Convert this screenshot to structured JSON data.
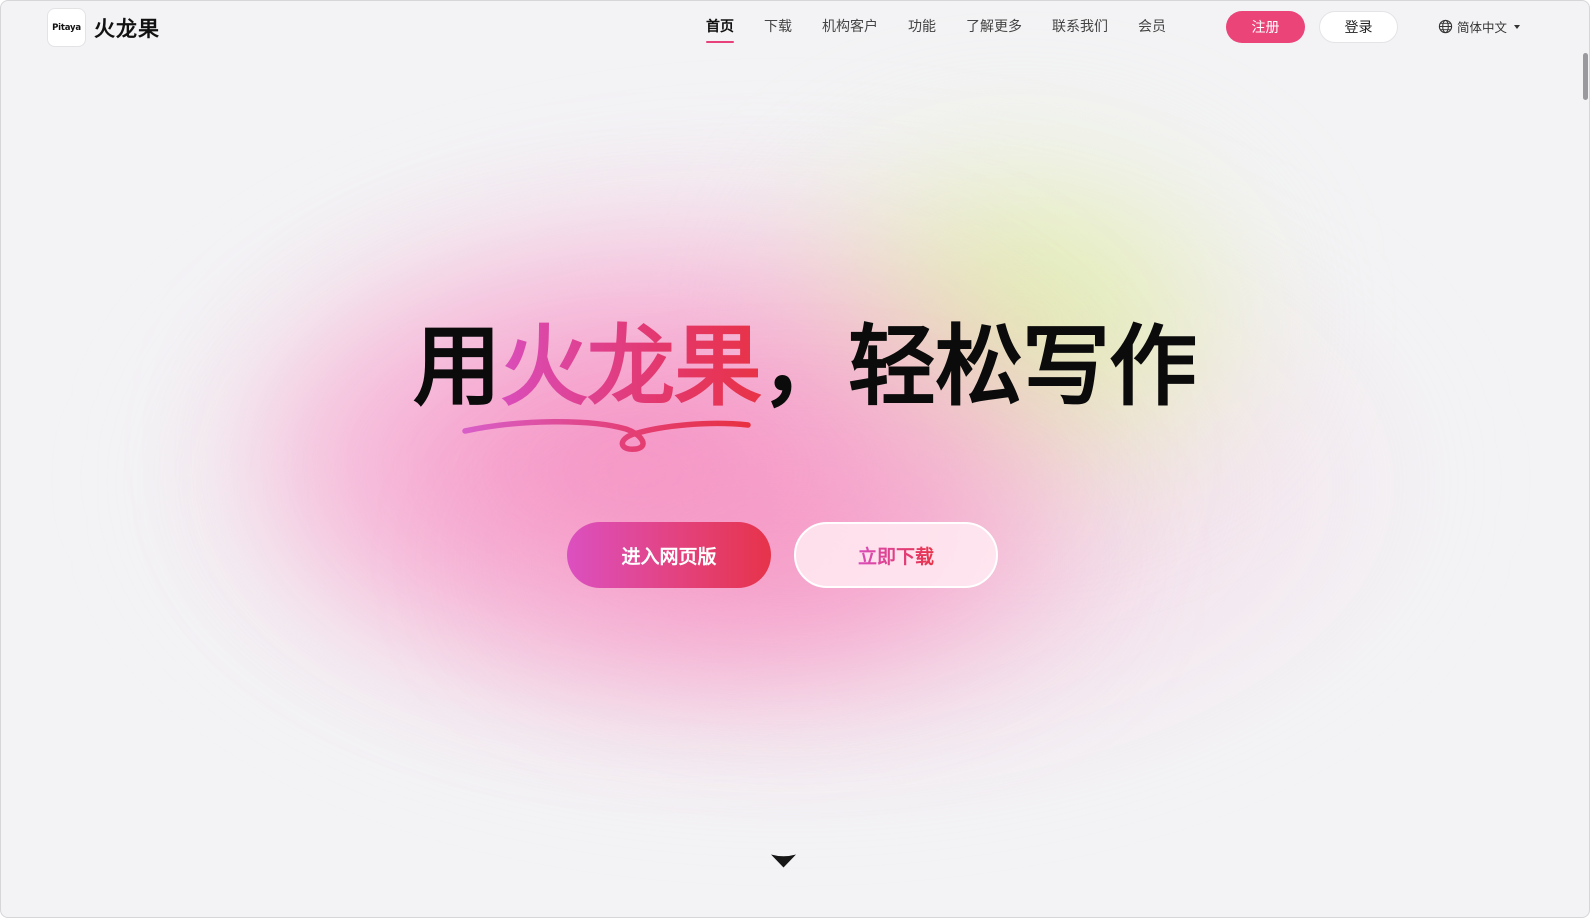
{
  "header": {
    "logo_text": "Pitaya",
    "brand": "火龙果",
    "nav": [
      {
        "label": "首页",
        "active": true
      },
      {
        "label": "下载"
      },
      {
        "label": "机构客户"
      },
      {
        "label": "功能"
      },
      {
        "label": "了解更多"
      },
      {
        "label": "联系我们"
      },
      {
        "label": "会员"
      }
    ],
    "register_label": "注册",
    "login_label": "登录",
    "language": "简体中文",
    "language_icon": "globe-icon"
  },
  "hero": {
    "title_prefix": "用",
    "title_accent": "火龙果",
    "title_suffix": "，轻松写作",
    "primary_button": "进入网页版",
    "secondary_button": "立即下载",
    "scroll_icon": "chevron-down-icon"
  },
  "colors": {
    "accent": "#ea4479",
    "accent_gradient_start": "#d94dbb",
    "accent_gradient_end": "#e8334a",
    "background": "#f3f3f5",
    "glow_green": "#dcf0a0",
    "glow_pink": "#f678b8"
  }
}
